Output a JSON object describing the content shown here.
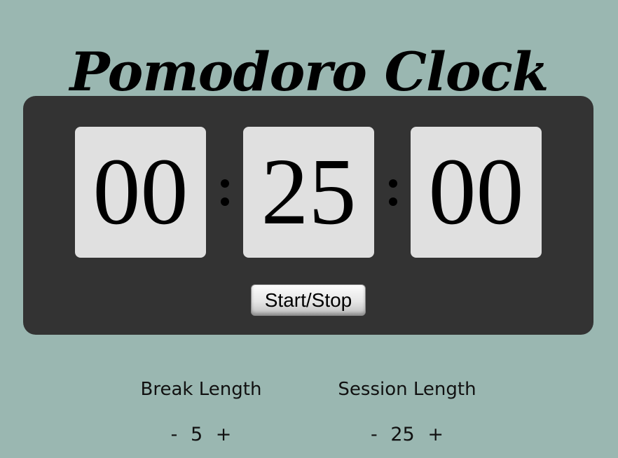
{
  "app": {
    "title": "Pomodoro Clock"
  },
  "clock": {
    "hours": "00",
    "minutes": "25",
    "seconds": "00",
    "start_stop_label": "Start/Stop"
  },
  "settings": {
    "break": {
      "label": "Break Length",
      "decrement": "-",
      "value": "5",
      "increment": "+"
    },
    "session": {
      "label": "Session Length",
      "decrement": "-",
      "value": "25",
      "increment": "+"
    }
  },
  "colors": {
    "background": "#9ab7b1",
    "panel": "#333333",
    "digit_box": "#e0e0e0",
    "text": "#000000"
  }
}
